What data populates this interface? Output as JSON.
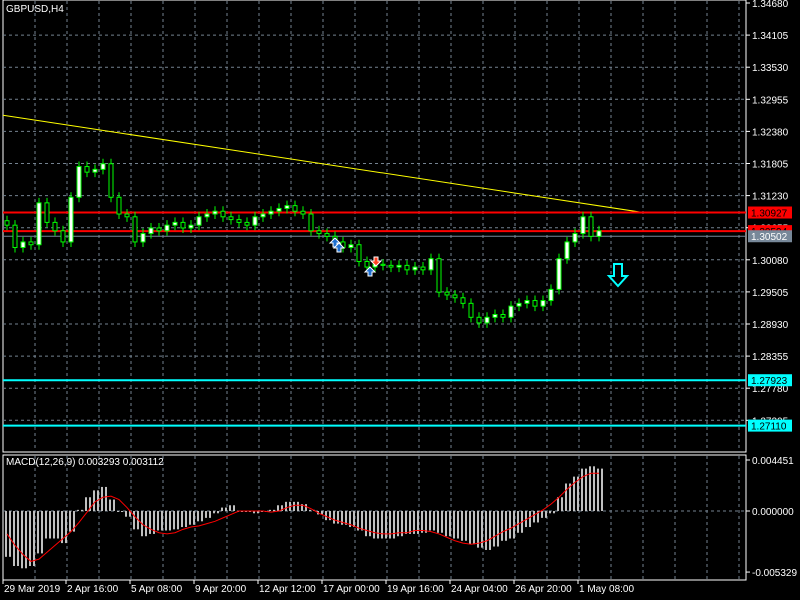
{
  "chart_title": "GBPUSD,H4",
  "macd_title": "MACD(12,26,9) 0.003293 0.003112",
  "colors": {
    "background": "#000000",
    "grid": "#748290",
    "bull": "#ffffff",
    "wick": "#00ff00",
    "trend": "#ffff00",
    "resistance": "#ff0000",
    "support": "#00ffff",
    "bid": "#778899",
    "macd_hist": "#c0c0c0",
    "macd_signal": "#ff0000"
  },
  "chart_data": [
    {
      "type": "candlestick",
      "symbol": "GBPUSD",
      "timeframe": "H4",
      "ylim": [
        1.27205,
        1.3468
      ],
      "y_ticks": [
        "1.34680",
        "1.34105",
        "1.33530",
        "1.32955",
        "1.32380",
        "1.31805",
        "1.31230",
        "1.30655",
        "1.30080",
        "1.29505",
        "1.28930",
        "1.28355",
        "1.27780",
        "1.27205"
      ],
      "x_labels": [
        "29 Mar 2019",
        "2 Apr 16:00",
        "5 Apr 08:00",
        "9 Apr 20:00",
        "12 Apr 12:00",
        "17 Apr 00:00",
        "19 Apr 16:00",
        "24 Apr 04:00",
        "26 Apr 20:00",
        "1 May 08:00"
      ],
      "closes": [
        1.307,
        1.303,
        1.304,
        1.3035,
        1.311,
        1.3075,
        1.306,
        1.304,
        1.312,
        1.3175,
        1.3165,
        1.317,
        1.318,
        1.312,
        1.309,
        1.3085,
        1.304,
        1.3055,
        1.3065,
        1.306,
        1.307,
        1.3075,
        1.3065,
        1.307,
        1.3085,
        1.309,
        1.3095,
        1.3085,
        1.308,
        1.3075,
        1.307,
        1.3085,
        1.309,
        1.3095,
        1.31,
        1.3105,
        1.3095,
        1.309,
        1.306,
        1.3055,
        1.305,
        1.304,
        1.303,
        1.3035,
        1.3005,
        1.2995,
        1.3,
        1.2998,
        1.2995,
        1.2998,
        1.299,
        1.2995,
        1.299,
        1.301,
        1.295,
        1.2945,
        1.294,
        1.293,
        1.2905,
        1.2895,
        1.2905,
        1.291,
        1.2905,
        1.2925,
        1.293,
        1.2935,
        1.2925,
        1.2935,
        1.2955,
        1.301,
        1.304,
        1.3055,
        1.3085,
        1.305,
        1.306
      ],
      "levels": [
        {
          "name": "resistance-upper",
          "price": "1.30927",
          "kind": "resistance"
        },
        {
          "name": "resistance-lower",
          "price": "1.30594",
          "kind": "resistance"
        },
        {
          "name": "bid",
          "price": "1.30502",
          "kind": "bid"
        },
        {
          "name": "support-upper",
          "price": "1.27923",
          "kind": "support"
        },
        {
          "name": "support-lower",
          "price": "1.27110",
          "kind": "support"
        }
      ],
      "trendline": {
        "from_price": 1.3267,
        "to_price": 1.3093
      }
    },
    {
      "type": "bar",
      "name": "MACD(12,26,9)",
      "ylim": [
        -0.005329,
        0.004451
      ],
      "y_ticks": [
        "0.004451",
        "0.000000",
        "-0.005329"
      ],
      "histogram": [
        -0.004,
        -0.0048,
        -0.005,
        -0.0048,
        -0.0037,
        -0.0024,
        -0.0024,
        -0.0028,
        -0.0018,
        0.0001,
        0.0012,
        0.0018,
        0.0021,
        0.001,
        0.0,
        -0.0005,
        -0.0016,
        -0.0022,
        -0.002,
        -0.0017,
        -0.0017,
        -0.0016,
        -0.0014,
        -0.0012,
        -0.0009,
        -0.0006,
        -0.0002,
        0.0003,
        0.0005,
        0.0,
        0.0,
        -0.0002,
        0.0,
        0.0001,
        0.0005,
        0.0008,
        0.0008,
        0.0006,
        0.0001,
        -0.0003,
        -0.0008,
        -0.0011,
        -0.0012,
        -0.0014,
        -0.0017,
        -0.0022,
        -0.0024,
        -0.0024,
        -0.0024,
        -0.0022,
        -0.002,
        -0.002,
        -0.0019,
        -0.0017,
        -0.0019,
        -0.0022,
        -0.0024,
        -0.0026,
        -0.0029,
        -0.0032,
        -0.0034,
        -0.0031,
        -0.0026,
        -0.0024,
        -0.0019,
        -0.0014,
        -0.001,
        -0.0006,
        -0.0002,
        0.0012,
        0.0024,
        0.003,
        0.0037,
        0.0039,
        0.0037
      ],
      "signal": [
        -0.002,
        -0.003,
        -0.0038,
        -0.0044,
        -0.0042,
        -0.0036,
        -0.003,
        -0.0024,
        -0.0018,
        -0.001,
        -0.0001,
        0.0008,
        0.0012,
        0.0013,
        0.001,
        0.0003,
        -0.0005,
        -0.0012,
        -0.0016,
        -0.0019,
        -0.002,
        -0.0019,
        -0.0016,
        -0.0014,
        -0.0013,
        -0.0011,
        -0.0009,
        -0.0006,
        -0.0003,
        0.0,
        0.0,
        0.0,
        0.0,
        -0.0001,
        0.0,
        0.0003,
        0.0005,
        0.0005,
        0.0002,
        -0.0002,
        -0.0005,
        -0.0008,
        -0.001,
        -0.0012,
        -0.0015,
        -0.0017,
        -0.0019,
        -0.002,
        -0.002,
        -0.0019,
        -0.0019,
        -0.0017,
        -0.0017,
        -0.0018,
        -0.002,
        -0.0023,
        -0.0026,
        -0.0028,
        -0.0029,
        -0.0028,
        -0.0026,
        -0.0022,
        -0.0018,
        -0.0015,
        -0.0011,
        -0.0007,
        -0.0003,
        0.0001,
        0.0006,
        0.0012,
        0.0019,
        0.0025,
        0.003,
        0.0033,
        0.0033
      ]
    }
  ]
}
